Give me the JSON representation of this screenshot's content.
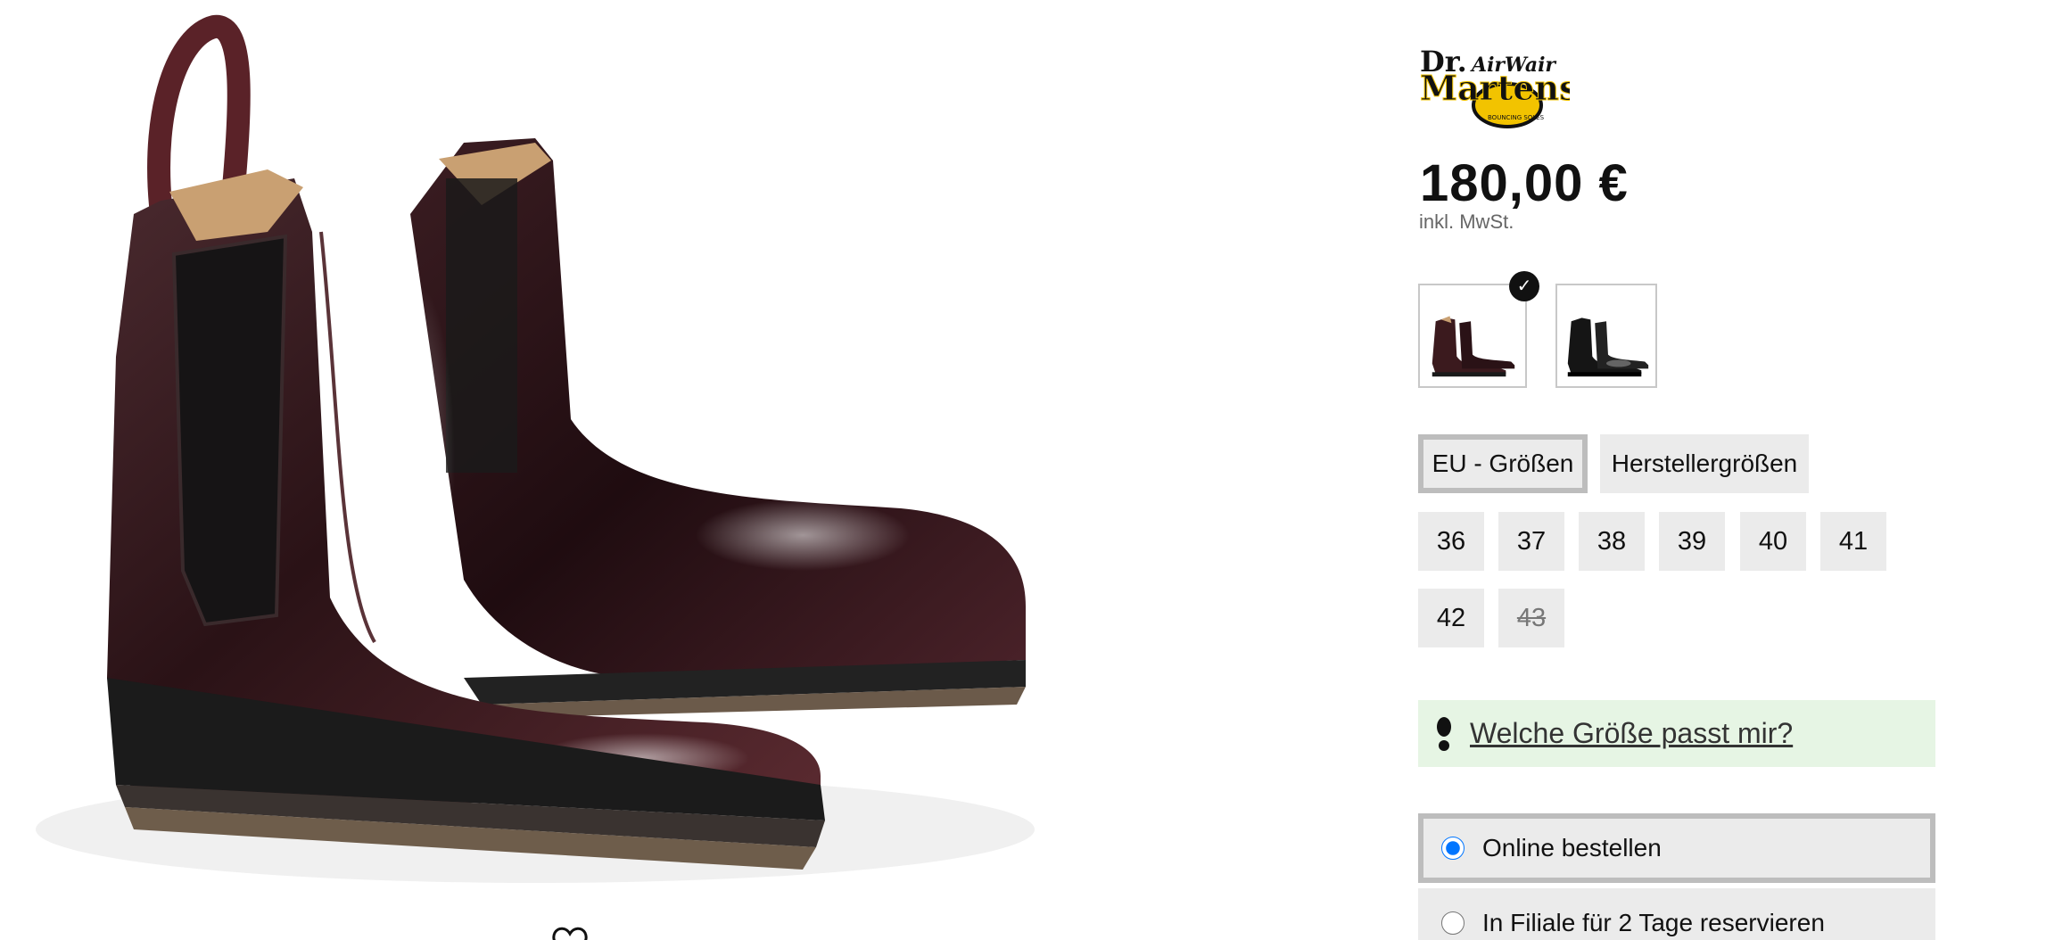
{
  "product": {
    "image_alt": "Dr. Martens Chelsea Boots",
    "wishlist_icon": "heart-icon"
  },
  "brand": {
    "logo_line1": "Dr.",
    "logo_line2": "Martens",
    "logo_air": "AirWair",
    "logo_tag": "BOUNCING SOLES",
    "logo_color": "#111111",
    "logo_accent": "#f2c300"
  },
  "price": {
    "amount": "180,00 €",
    "tax_note": "inkl. MwSt."
  },
  "colors": {
    "selected_index": 0,
    "swatches": [
      {
        "name": "Bordeaux",
        "color": "#3b1a1e"
      },
      {
        "name": "Schwarz",
        "color": "#151515"
      }
    ],
    "check_icon": "checkmark-icon"
  },
  "size_system": {
    "eu_label": "EU - Größen",
    "manufacturer_label": "Herstellergrößen",
    "selected": "eu"
  },
  "sizes": [
    {
      "label": "36",
      "available": true
    },
    {
      "label": "37",
      "available": true
    },
    {
      "label": "38",
      "available": true
    },
    {
      "label": "39",
      "available": true
    },
    {
      "label": "40",
      "available": true
    },
    {
      "label": "41",
      "available": true
    },
    {
      "label": "42",
      "available": true
    },
    {
      "label": "43",
      "available": false
    }
  ],
  "size_help": {
    "icon": "footprint-icon",
    "label": "Welche Größe passt mir?"
  },
  "order_options": {
    "selected": "online",
    "online_label": "Online bestellen",
    "store_label": "In Filiale für 2 Tage reservieren"
  },
  "accent_colors": {
    "help_background": "#e6f5e4",
    "radio_selected": "#1a73e8"
  }
}
